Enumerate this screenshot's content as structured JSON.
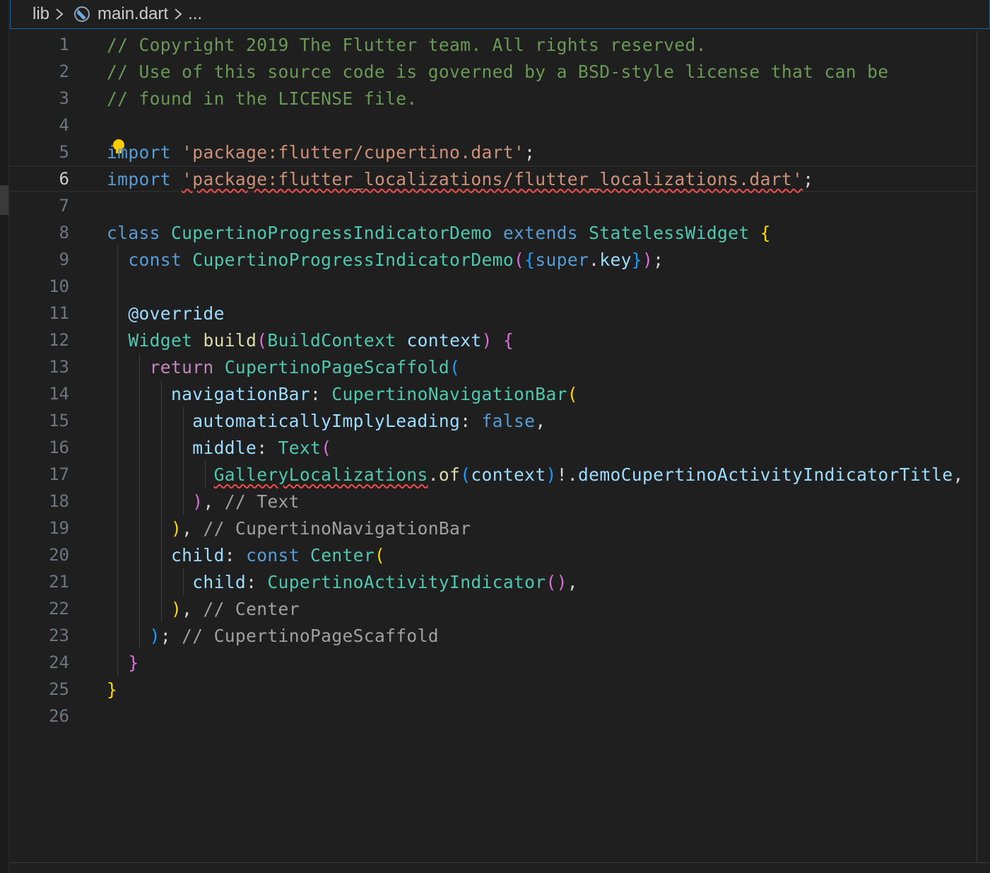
{
  "breadcrumb": {
    "folder": "lib",
    "file": "main.dart",
    "more": "..."
  },
  "icons": {
    "chevron": "chevron-right-icon",
    "file": "dart-file-icon",
    "lightbulb": "lightbulb-icon"
  },
  "colors": {
    "background": "#1f1f1f",
    "comment": "#6a9955",
    "keyword": "#569cd6",
    "control": "#c586c0",
    "string": "#ce9178",
    "type": "#4ec9b0",
    "function": "#dcdcaa",
    "variable": "#9cdcfe",
    "error_squiggle": "#f14c4c",
    "focus_border": "#0e639c"
  },
  "editor": {
    "current_line": 6,
    "lines": [
      {
        "n": "1",
        "tokens": [
          [
            "comment",
            "// Copyright 2019 The Flutter team. All rights reserved."
          ]
        ]
      },
      {
        "n": "2",
        "tokens": [
          [
            "comment",
            "// Use of this source code is governed by a BSD-style license that can be"
          ]
        ]
      },
      {
        "n": "3",
        "tokens": [
          [
            "comment",
            "// found in the LICENSE file."
          ]
        ]
      },
      {
        "n": "4",
        "tokens": []
      },
      {
        "n": "5",
        "tokens": [
          [
            "kw",
            "import"
          ],
          [
            "plain",
            " "
          ],
          [
            "str",
            "'package:flutter/cupertino.dart'"
          ],
          [
            "plain",
            ";"
          ]
        ]
      },
      {
        "n": "6",
        "tokens": [
          [
            "kw",
            "import"
          ],
          [
            "plain",
            " "
          ],
          [
            "str-err",
            "'package:flutter_localizations/flutter_localizations.dart'"
          ],
          [
            "plain",
            ";"
          ]
        ]
      },
      {
        "n": "7",
        "tokens": []
      },
      {
        "n": "8",
        "tokens": [
          [
            "kw",
            "class"
          ],
          [
            "plain",
            " "
          ],
          [
            "type",
            "CupertinoProgressIndicatorDemo"
          ],
          [
            "plain",
            " "
          ],
          [
            "kw",
            "extends"
          ],
          [
            "plain",
            " "
          ],
          [
            "type",
            "StatelessWidget"
          ],
          [
            "plain",
            " "
          ],
          [
            "br1",
            "{"
          ]
        ]
      },
      {
        "n": "9",
        "tokens": [
          [
            "plain",
            "  "
          ],
          [
            "kw",
            "const"
          ],
          [
            "plain",
            " "
          ],
          [
            "type",
            "CupertinoProgressIndicatorDemo"
          ],
          [
            "br2",
            "("
          ],
          [
            "br3",
            "{"
          ],
          [
            "kw",
            "super"
          ],
          [
            "plain",
            "."
          ],
          [
            "var",
            "key"
          ],
          [
            "br3",
            "}"
          ],
          [
            "br2",
            ")"
          ],
          [
            "plain",
            ";"
          ]
        ]
      },
      {
        "n": "10",
        "tokens": []
      },
      {
        "n": "11",
        "tokens": [
          [
            "plain",
            "  "
          ],
          [
            "var",
            "@override"
          ]
        ]
      },
      {
        "n": "12",
        "tokens": [
          [
            "plain",
            "  "
          ],
          [
            "type",
            "Widget"
          ],
          [
            "plain",
            " "
          ],
          [
            "fn",
            "build"
          ],
          [
            "br2",
            "("
          ],
          [
            "type",
            "BuildContext"
          ],
          [
            "plain",
            " "
          ],
          [
            "var",
            "context"
          ],
          [
            "br2",
            ")"
          ],
          [
            "plain",
            " "
          ],
          [
            "br2",
            "{"
          ]
        ]
      },
      {
        "n": "13",
        "tokens": [
          [
            "plain",
            "    "
          ],
          [
            "ctrl",
            "return"
          ],
          [
            "plain",
            " "
          ],
          [
            "type",
            "CupertinoPageScaffold"
          ],
          [
            "br3",
            "("
          ]
        ]
      },
      {
        "n": "14",
        "tokens": [
          [
            "plain",
            "      "
          ],
          [
            "var",
            "navigationBar"
          ],
          [
            "plain",
            ": "
          ],
          [
            "type",
            "CupertinoNavigationBar"
          ],
          [
            "br1",
            "("
          ]
        ]
      },
      {
        "n": "15",
        "tokens": [
          [
            "plain",
            "        "
          ],
          [
            "var",
            "automaticallyImplyLeading"
          ],
          [
            "plain",
            ": "
          ],
          [
            "kw",
            "false"
          ],
          [
            "plain",
            ","
          ]
        ]
      },
      {
        "n": "16",
        "tokens": [
          [
            "plain",
            "        "
          ],
          [
            "var",
            "middle"
          ],
          [
            "plain",
            ": "
          ],
          [
            "type",
            "Text"
          ],
          [
            "br2",
            "("
          ]
        ]
      },
      {
        "n": "17",
        "tokens": [
          [
            "plain",
            "          "
          ],
          [
            "type-err",
            "GalleryLocalizations"
          ],
          [
            "plain",
            "."
          ],
          [
            "fn",
            "of"
          ],
          [
            "br3",
            "("
          ],
          [
            "var",
            "context"
          ],
          [
            "br3",
            ")"
          ],
          [
            "plain",
            "!."
          ],
          [
            "var",
            "demoCupertinoActivityIndicatorTitle"
          ],
          [
            "plain",
            ","
          ]
        ]
      },
      {
        "n": "18",
        "tokens": [
          [
            "plain",
            "        "
          ],
          [
            "br2",
            ")"
          ],
          [
            "plain",
            ", "
          ],
          [
            "gray",
            "// Text"
          ]
        ]
      },
      {
        "n": "19",
        "tokens": [
          [
            "plain",
            "      "
          ],
          [
            "br1",
            ")"
          ],
          [
            "plain",
            ", "
          ],
          [
            "gray",
            "// CupertinoNavigationBar"
          ]
        ]
      },
      {
        "n": "20",
        "tokens": [
          [
            "plain",
            "      "
          ],
          [
            "var",
            "child"
          ],
          [
            "plain",
            ": "
          ],
          [
            "kw",
            "const"
          ],
          [
            "plain",
            " "
          ],
          [
            "type",
            "Center"
          ],
          [
            "br1",
            "("
          ]
        ]
      },
      {
        "n": "21",
        "tokens": [
          [
            "plain",
            "        "
          ],
          [
            "var",
            "child"
          ],
          [
            "plain",
            ": "
          ],
          [
            "type",
            "CupertinoActivityIndicator"
          ],
          [
            "br2",
            "()"
          ],
          [
            "plain",
            ","
          ]
        ]
      },
      {
        "n": "22",
        "tokens": [
          [
            "plain",
            "      "
          ],
          [
            "br1",
            ")"
          ],
          [
            "plain",
            ", "
          ],
          [
            "gray",
            "// Center"
          ]
        ]
      },
      {
        "n": "23",
        "tokens": [
          [
            "plain",
            "    "
          ],
          [
            "br3",
            ")"
          ],
          [
            "plain",
            "; "
          ],
          [
            "gray",
            "// CupertinoPageScaffold"
          ]
        ]
      },
      {
        "n": "24",
        "tokens": [
          [
            "plain",
            "  "
          ],
          [
            "br2",
            "}"
          ]
        ]
      },
      {
        "n": "25",
        "tokens": [
          [
            "br1",
            "}"
          ]
        ]
      },
      {
        "n": "26",
        "tokens": []
      }
    ]
  }
}
